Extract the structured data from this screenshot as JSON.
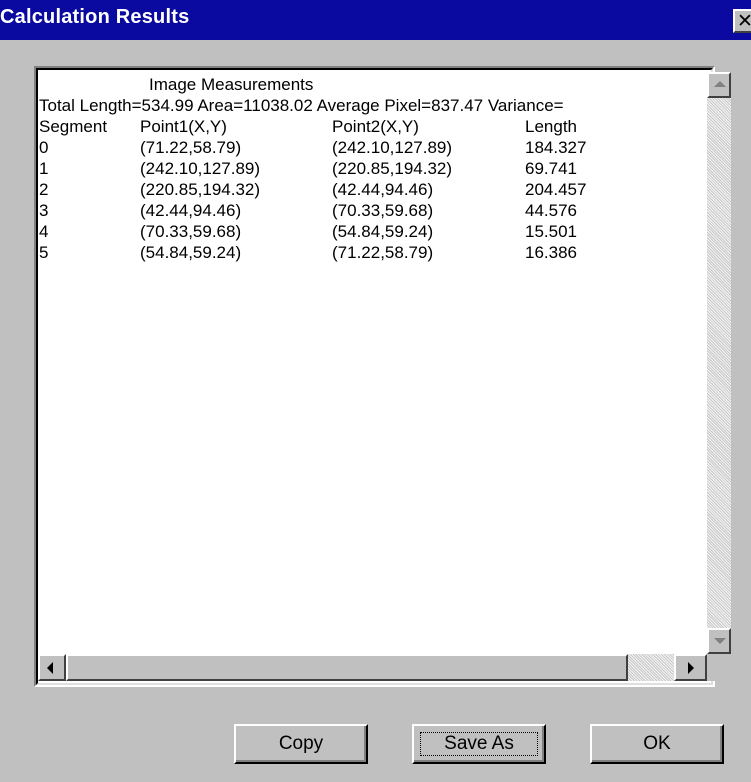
{
  "window": {
    "title": "Calculation Results",
    "close_glyph": "✕"
  },
  "results": {
    "heading": "Image Measurements",
    "summary": "Total Length=534.99 Area=11038.02 Average Pixel=837.47 Variance=",
    "columns": [
      "Segment",
      "Point1(X,Y)",
      "Point2(X,Y)",
      "Length"
    ],
    "rows": [
      [
        "0",
        "(71.22,58.79)",
        "(242.10,127.89)",
        "184.327"
      ],
      [
        "1",
        "(242.10,127.89)",
        "(220.85,194.32)",
        "69.741"
      ],
      [
        "2",
        "(220.85,194.32)",
        "(42.44,94.46)",
        "204.457"
      ],
      [
        "3",
        "(42.44,94.46)",
        "(70.33,59.68)",
        "44.576"
      ],
      [
        "4",
        "(70.33,59.68)",
        "(54.84,59.24)",
        "15.501"
      ],
      [
        "5",
        "(54.84,59.24)",
        "(71.22,58.79)",
        "16.386"
      ]
    ]
  },
  "buttons": {
    "copy": "Copy",
    "save_as": "Save As",
    "ok": "OK"
  },
  "icons": {
    "scroll_up": "scroll-up-arrow-icon",
    "scroll_down": "scroll-down-arrow-icon",
    "scroll_left": "scroll-left-arrow-icon",
    "scroll_right": "scroll-right-arrow-icon"
  }
}
